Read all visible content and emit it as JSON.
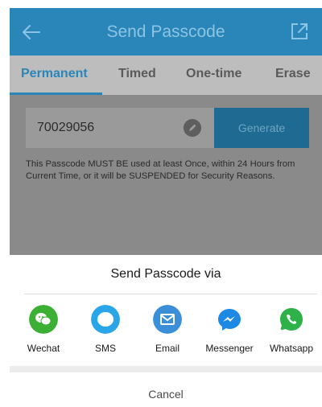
{
  "header": {
    "title": "Send Passcode"
  },
  "tabs": [
    {
      "label": "Permanent",
      "active": true
    },
    {
      "label": "Timed",
      "active": false
    },
    {
      "label": "One-time",
      "active": false
    },
    {
      "label": "Erase",
      "active": false
    }
  ],
  "passcode": {
    "value": "70029056",
    "generate_label": "Generate",
    "notice": "This Passcode MUST BE used at least Once, within 24 Hours from Current Time, or it will be SUSPENDED for Security Reasons."
  },
  "share_sheet": {
    "title": "Send Passcode via",
    "options": [
      {
        "label": "Wechat",
        "icon": "wechat-icon",
        "color": "#3cb034"
      },
      {
        "label": "SMS",
        "icon": "sms-icon",
        "color": "#2aa5e8"
      },
      {
        "label": "Email",
        "icon": "email-icon",
        "color": "#3a8fd8"
      },
      {
        "label": "Messenger",
        "icon": "messenger-icon",
        "color": "#1e88e5"
      },
      {
        "label": "Whatsapp",
        "icon": "whatsapp-icon",
        "color": "#2fb14a"
      }
    ],
    "cancel_label": "Cancel"
  },
  "colors": {
    "accent": "#2a86b8",
    "overlay_panel": "#8a8a8a",
    "tab_bar": "#bdbdbd"
  }
}
